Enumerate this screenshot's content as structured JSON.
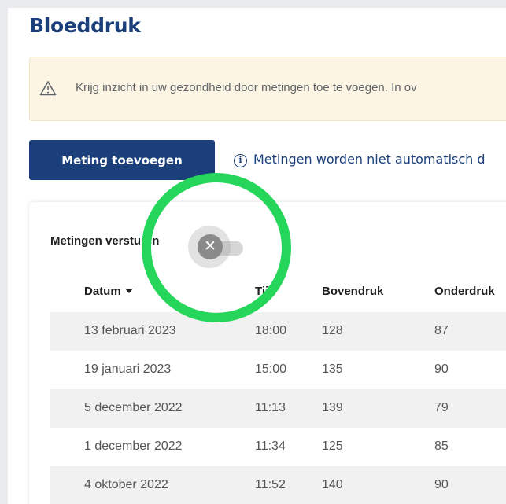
{
  "page": {
    "title": "Bloeddruk"
  },
  "notice": {
    "icon": "warning-triangle-icon",
    "text": "Krijg inzicht in uw gezondheid door metingen toe te voegen. In ov"
  },
  "toolbar": {
    "add_label": "Meting toevoegen",
    "info_icon": "info-circle-icon",
    "info_text": "Metingen worden niet automatisch d"
  },
  "send": {
    "label": "Metingen versturen",
    "toggle_state": "off",
    "toggle_icon": "close-icon"
  },
  "table": {
    "headers": {
      "date": "Datum",
      "time": "Tijd",
      "systolic": "Bovendruk",
      "diastolic": "Onderdruk"
    },
    "sort_icon": "caret-down-icon",
    "rows": [
      {
        "date": "13 februari 2023",
        "time": "18:00",
        "systolic": "128",
        "diastolic": "87"
      },
      {
        "date": "19 januari 2023",
        "time": "15:00",
        "systolic": "135",
        "diastolic": "90"
      },
      {
        "date": "5 december 2022",
        "time": "11:13",
        "systolic": "139",
        "diastolic": "79"
      },
      {
        "date": "1 december 2022",
        "time": "11:34",
        "systolic": "125",
        "diastolic": "85"
      },
      {
        "date": "4 oktober 2022",
        "time": "11:52",
        "systolic": "140",
        "diastolic": "90"
      }
    ]
  },
  "colors": {
    "brand_blue": "#1b3f7a",
    "notice_bg": "#fdf5e4",
    "highlight": "#25d65a",
    "toggle_off": "#8a8a8a"
  }
}
